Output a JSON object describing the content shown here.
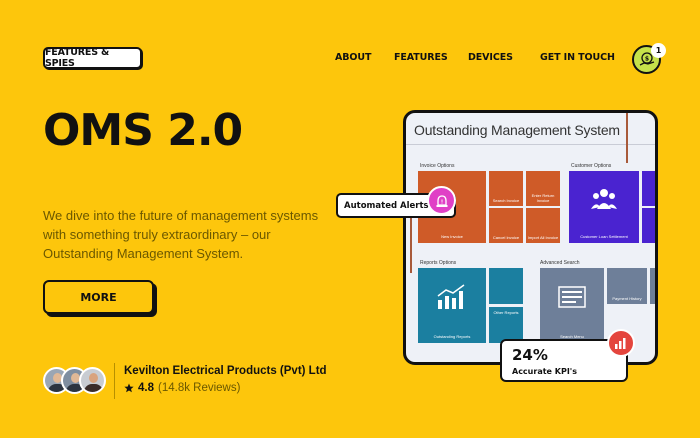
{
  "header": {
    "logo_label": "FEATURES & SPIES",
    "nav": [
      "ABOUT",
      "FEATURES",
      "DEVICES",
      "GET IN TOUCH"
    ],
    "cart_count": "1"
  },
  "hero": {
    "title": "OMS 2.0",
    "description": "We dive into the future of management systems with something truly extraordinary – our Outstanding Management System.",
    "more_label": "MORE"
  },
  "review": {
    "company": "Kevilton Electrical Products (Pvt) Ltd",
    "rating": "4.8",
    "reviews": "(14.8k Reviews)"
  },
  "preview": {
    "title": "Outstanding Management System",
    "sections": {
      "invoice": "Invoice Options",
      "customer": "Customer Options",
      "reports": "Reports Options",
      "advanced": "Advanced Search"
    },
    "tiles": {
      "new_invoice": "New Invoice",
      "search_invoice": "Search Invoice",
      "enter_return": "Enter Return Invoice",
      "cancel_invoice": "Cancel Invoice",
      "import_invoice": "Import All Invoice",
      "customer_loan": "Customer Loan Settlement",
      "outstanding_reports": "Outstanding Reports",
      "other_reports": "Other Reports",
      "search_menu": "Search Menu",
      "payment_history": "Payment History"
    }
  },
  "badges": {
    "alert_label": "Automated Alerts",
    "kpi_value": "24%",
    "kpi_label": "Accurate KPI's"
  },
  "colors": {
    "background": "#fdc60c",
    "accent_green": "#c6e24a",
    "tile_orange": "#cf5b28",
    "tile_blue": "#4a23d0",
    "tile_teal": "#1b7fa0",
    "alert_pink": "#e040c6",
    "kpi_red": "#e4453d"
  }
}
